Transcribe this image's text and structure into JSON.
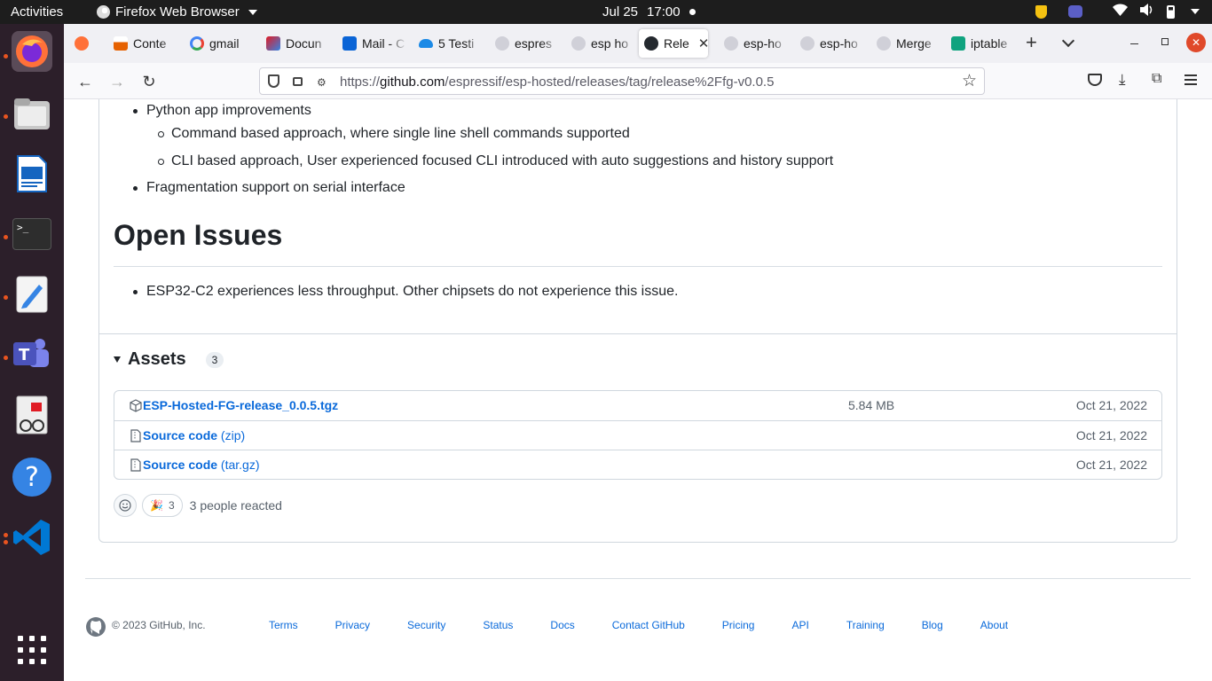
{
  "topbar": {
    "activities": "Activities",
    "app_name": "Firefox Web Browser",
    "date": "Jul 25",
    "time": "17:00"
  },
  "dock": {
    "items": [
      "firefox",
      "files",
      "libreoffice-writer",
      "terminal",
      "text-editor",
      "teams",
      "document-viewer",
      "help",
      "vscode"
    ],
    "apps_grid": "show-applications"
  },
  "browser": {
    "tabs": [
      {
        "label": "Conte"
      },
      {
        "label": "gmail"
      },
      {
        "label": "Docun"
      },
      {
        "label": "Mail - C"
      },
      {
        "label": "5 Testi"
      },
      {
        "label": "espres"
      },
      {
        "label": "esp ho"
      },
      {
        "label": "Rele"
      },
      {
        "label": "esp-ho"
      },
      {
        "label": "esp-ho"
      },
      {
        "label": "Merge"
      },
      {
        "label": "iptable"
      }
    ],
    "active_tab_index": 7,
    "url_prefix": "https://",
    "url_host": "github.com",
    "url_path": "/espressif/esp-hosted/releases/tag/release%2Ffg-v0.0.5"
  },
  "release_notes": {
    "python_improvements": "Python app improvements",
    "sub_items": [
      "Command based approach, where single line shell commands supported",
      "CLI based approach, User experienced focused CLI introduced with auto suggestions and history support"
    ],
    "fragmentation": "Fragmentation support on serial interface",
    "open_issues_heading": "Open Issues",
    "open_issue_item": "ESP32-C2 experiences less throughput. Other chipsets do not experience this issue."
  },
  "assets": {
    "title": "Assets",
    "count": "3",
    "rows": [
      {
        "name": "ESP-Hosted-FG-release_0.0.5.tgz",
        "sub": "",
        "size": "5.84 MB",
        "date": "Oct 21, 2022"
      },
      {
        "name": "Source code",
        "sub": "(zip)",
        "size": "",
        "date": "Oct 21, 2022"
      },
      {
        "name": "Source code",
        "sub": "(tar.gz)",
        "size": "",
        "date": "Oct 21, 2022"
      }
    ]
  },
  "reactions": {
    "emoji": "🎉",
    "count": "3",
    "summary": "3 people reacted"
  },
  "footer": {
    "copyright": "© 2023 GitHub, Inc.",
    "links": [
      "Terms",
      "Privacy",
      "Security",
      "Status",
      "Docs",
      "Contact GitHub",
      "Pricing",
      "API",
      "Training",
      "Blog",
      "About"
    ]
  }
}
